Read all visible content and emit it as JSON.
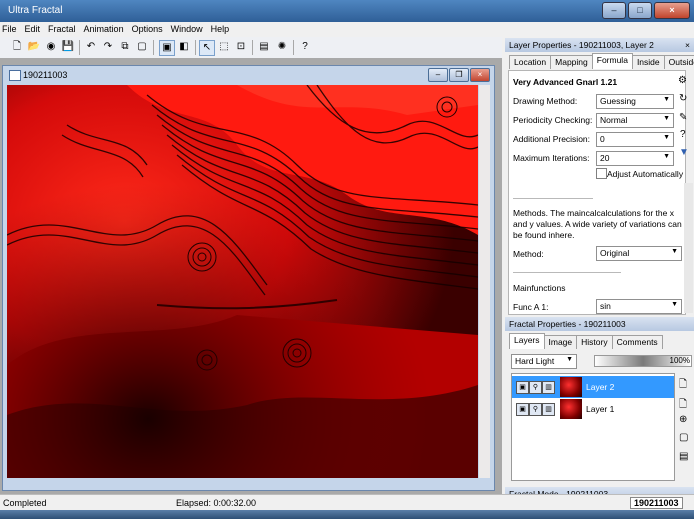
{
  "app": {
    "title": "Ultra Fractal"
  },
  "menu": [
    "File",
    "Edit",
    "Fractal",
    "Animation",
    "Options",
    "Window",
    "Help"
  ],
  "document": {
    "title": "190211003"
  },
  "layer_properties": {
    "title": "Layer Properties - 190211003, Layer 2",
    "tabs": [
      "Location",
      "Mapping",
      "Formula",
      "Inside",
      "Outside"
    ],
    "formula_name": "Very Advanced Gnarl 1.21",
    "drawing_method": {
      "label": "Drawing Method:",
      "value": "Guessing"
    },
    "periodicity": {
      "label": "Periodicity Checking:",
      "value": "Normal"
    },
    "precision": {
      "label": "Additional Precision:",
      "value": "0"
    },
    "iterations": {
      "label": "Maximum Iterations:",
      "value": "20"
    },
    "adjust_auto": "Adjust Automatically",
    "methods_text": "Methods. The maincalcalculations for the x and y values. A wide variety of variations can be found inhere.",
    "method": {
      "label": "Method:",
      "value": "Original"
    },
    "mainfunctions": "Mainfunctions",
    "func_a1": {
      "label": "Func A 1:",
      "value": "sin"
    }
  },
  "fractal_properties": {
    "title": "Fractal Properties - 190211003",
    "tabs": [
      "Layers",
      "Image",
      "History",
      "Comments"
    ],
    "merge_mode": "Hard Light",
    "opacity": "100%",
    "layers": [
      "Layer 2",
      "Layer 1"
    ]
  },
  "fractal_mode": {
    "title": "Fractal Mode - 190211003"
  },
  "status": {
    "left": "Completed",
    "elapsed": "Elapsed: 0:00:32.00",
    "right": "190211003"
  },
  "colors": {
    "accent": "#3399ff",
    "fractal_red": "#ff1010"
  }
}
